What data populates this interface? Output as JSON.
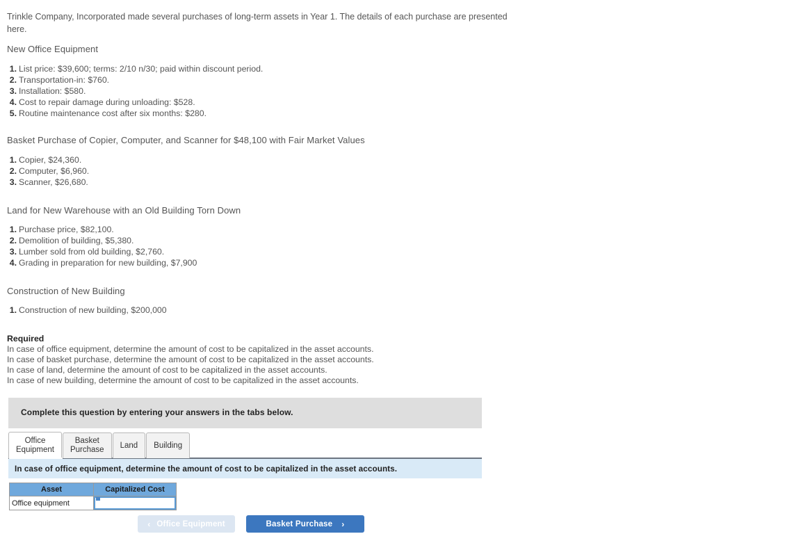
{
  "intro": "Trinkle Company, Incorporated made several purchases of long-term assets in Year 1. The details of each purchase are presented here.",
  "sections": [
    {
      "heading": "New Office Equipment",
      "items": [
        {
          "n": "1.",
          "text": "List price: $39,600; terms: 2/10 n/30; paid within discount period."
        },
        {
          "n": "2.",
          "text": "Transportation-in: $760."
        },
        {
          "n": "3.",
          "text": "Installation: $580."
        },
        {
          "n": "4.",
          "text": "Cost to repair damage during unloading: $528."
        },
        {
          "n": "5.",
          "text": "Routine maintenance cost after six months: $280."
        }
      ]
    },
    {
      "heading": "Basket Purchase of Copier, Computer, and Scanner for $48,100 with Fair Market Values",
      "items": [
        {
          "n": "1.",
          "text": "Copier, $24,360."
        },
        {
          "n": "2.",
          "text": "Computer, $6,960."
        },
        {
          "n": "3.",
          "text": "Scanner, $26,680."
        }
      ]
    },
    {
      "heading": "Land for New Warehouse with an Old Building Torn Down",
      "items": [
        {
          "n": "1.",
          "text": "Purchase price, $82,100."
        },
        {
          "n": "2.",
          "text": "Demolition of building, $5,380."
        },
        {
          "n": "3.",
          "text": "Lumber sold from old building, $2,760."
        },
        {
          "n": "4.",
          "text": "Grading in preparation for new building, $7,900"
        }
      ]
    },
    {
      "heading": "Construction of New Building",
      "items": [
        {
          "n": "1.",
          "text": "Construction of new building, $200,000"
        }
      ]
    }
  ],
  "required": {
    "title": "Required",
    "lines": [
      "In case of office equipment, determine the amount of cost to be capitalized in the asset accounts.",
      "In case of basket purchase, determine the amount of cost to be capitalized in the asset accounts.",
      "In case of land, determine the amount of cost to be capitalized in the asset accounts.",
      "In case of new building, determine the amount of cost to be capitalized in the asset accounts."
    ]
  },
  "banner": {
    "text": "Complete this question by entering your answers in the tabs below."
  },
  "tabs": [
    {
      "label_line1": "Office",
      "label_line2": "Equipment",
      "active": true
    },
    {
      "label_line1": "Basket",
      "label_line2": "Purchase",
      "active": false
    },
    {
      "label_line1": "Land",
      "label_line2": "",
      "active": false
    },
    {
      "label_line1": "Building",
      "label_line2": "",
      "active": false
    }
  ],
  "infobar": {
    "text": "In case of office equipment, determine the amount of cost to be capitalized in the asset accounts."
  },
  "answer_table": {
    "headers": [
      "Asset",
      "Capitalized Cost"
    ],
    "rows": [
      {
        "asset": "Office equipment",
        "capitalized_cost": "",
        "placeholder": ""
      }
    ]
  },
  "nav": {
    "prev_label": "Office Equipment",
    "prev_icon": "chevron-left",
    "prev_chevron": "‹",
    "next_label": "Basket Purchase",
    "next_icon": "chevron-right",
    "next_chevron": "›"
  },
  "colors": {
    "accent_blue": "#3c77bf",
    "table_header_blue": "#6fa8dc",
    "infobar_blue": "#d9eaf7",
    "banner_gray": "#dedede",
    "disabled_blue": "#dce6f2"
  }
}
